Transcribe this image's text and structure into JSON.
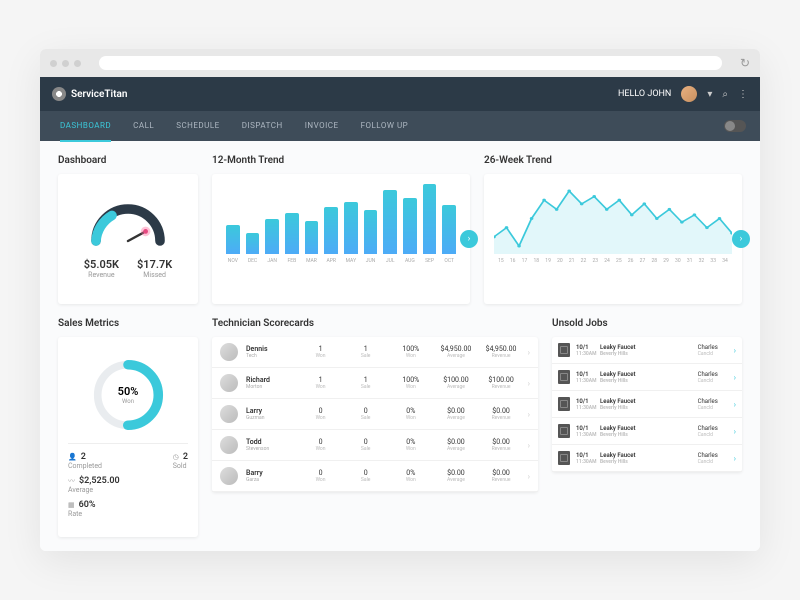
{
  "brand": "ServiceTitan",
  "greeting": "HELLO JOHN",
  "nav": [
    "DASHBOARD",
    "CALL",
    "SCHEDULE",
    "DISPATCH",
    "INVOICE",
    "FOLLOW UP"
  ],
  "activeNav": 0,
  "sections": {
    "dashboard": "Dashboard",
    "trend12": "12-Month Trend",
    "trend26": "26-Week Trend",
    "sales": "Sales Metrics",
    "scorecards": "Technician Scorecards",
    "unsold": "Unsold Jobs"
  },
  "gauge": {
    "revenue": {
      "val": "$5.05K",
      "label": "Revenue"
    },
    "missed": {
      "val": "$17.7K",
      "label": "Missed"
    }
  },
  "chart_data": [
    {
      "type": "bar",
      "title": "12-Month Trend",
      "categories": [
        "NOV",
        "DEC",
        "JAN",
        "FEB",
        "MAR",
        "APR",
        "MAY",
        "JUN",
        "JUL",
        "AUG",
        "SEP",
        "OCT"
      ],
      "values": [
        25,
        18,
        30,
        35,
        28,
        40,
        45,
        38,
        55,
        48,
        60,
        42
      ]
    },
    {
      "type": "line",
      "title": "26-Week Trend",
      "x": [
        15,
        16,
        17,
        18,
        19,
        20,
        21,
        22,
        23,
        24,
        25,
        26,
        27,
        28,
        29,
        30,
        31,
        32,
        33,
        34
      ],
      "values": [
        40,
        45,
        35,
        50,
        60,
        55,
        65,
        58,
        62,
        55,
        60,
        52,
        58,
        50,
        55,
        48,
        52,
        45,
        50,
        42
      ]
    }
  ],
  "salesMetrics": {
    "wonPct": "50%",
    "wonLabel": "Won",
    "completed": {
      "val": "2",
      "label": "Completed"
    },
    "sold": {
      "val": "2",
      "label": "Sold"
    },
    "average": {
      "val": "$2,525.00",
      "label": "Average"
    },
    "rate": {
      "val": "60%",
      "label": "Rate"
    }
  },
  "technicians": [
    {
      "name": "Dennis",
      "sub": "Tech",
      "won": "1",
      "sale": "1",
      "pct": "100%",
      "avg": "$4,950.00",
      "rev": "$4,950.00"
    },
    {
      "name": "Richard",
      "sub": "Morton",
      "won": "1",
      "sale": "1",
      "pct": "100%",
      "avg": "$100.00",
      "rev": "$100.00"
    },
    {
      "name": "Larry",
      "sub": "Guzman",
      "won": "0",
      "sale": "0",
      "pct": "0%",
      "avg": "$0.00",
      "rev": "$0.00"
    },
    {
      "name": "Todd",
      "sub": "Stevenson",
      "won": "0",
      "sale": "0",
      "pct": "0%",
      "avg": "$0.00",
      "rev": "$0.00"
    },
    {
      "name": "Barry",
      "sub": "Garza",
      "won": "0",
      "sale": "0",
      "pct": "0%",
      "avg": "$0.00",
      "rev": "$0.00"
    }
  ],
  "techHeaders": {
    "won": "Won",
    "sale": "Sale",
    "pct": "Won",
    "avg": "Average",
    "rev": "Revenue"
  },
  "unsoldJobs": [
    {
      "date": "10/1",
      "time": "11:30AM",
      "title": "Leaky Faucet",
      "loc": "Beverly Hills",
      "who": "Charles",
      "status": "Cancld"
    },
    {
      "date": "10/1",
      "time": "11:30AM",
      "title": "Leaky Faucet",
      "loc": "Beverly Hills",
      "who": "Charles",
      "status": "Cancld"
    },
    {
      "date": "10/1",
      "time": "11:30AM",
      "title": "Leaky Faucet",
      "loc": "Beverly Hills",
      "who": "Charles",
      "status": "Cancld"
    },
    {
      "date": "10/1",
      "time": "11:30AM",
      "title": "Leaky Faucet",
      "loc": "Beverly Hills",
      "who": "Charles",
      "status": "Cancld"
    },
    {
      "date": "10/1",
      "time": "11:30AM",
      "title": "Leaky Faucet",
      "loc": "Beverly Hills",
      "who": "Charles",
      "status": "Cancld"
    }
  ]
}
